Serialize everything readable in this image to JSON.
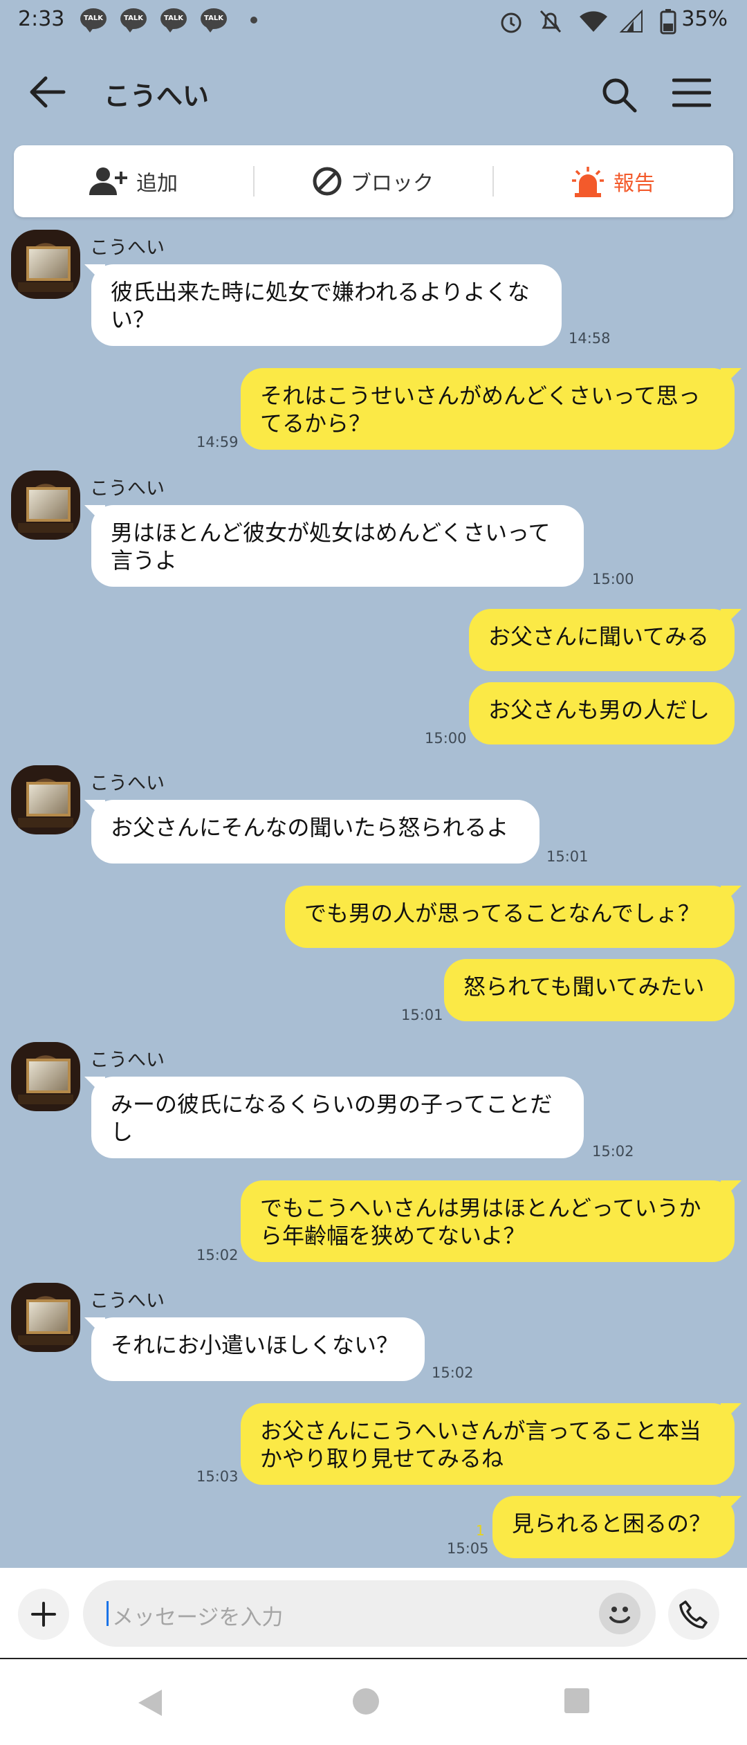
{
  "status": {
    "time": "2:33",
    "talk_label": "TALK",
    "battery": "35%"
  },
  "header": {
    "title": "こうへい"
  },
  "actions": {
    "add": "追加",
    "block": "ブロック",
    "report": "報告"
  },
  "messages": [
    {
      "sender": "こうへい",
      "text": "彼氏出来た時に処女で嫌われるよりよくな\nい？",
      "time": "14:58"
    },
    {
      "text": "それはこうせいさんがめんどくさいって思っ\nてるから？",
      "time": "14:59"
    },
    {
      "sender": "こうへい",
      "text": "男はほとんど彼女が処女はめんどくさいって\n言うよ",
      "time": "15:00"
    },
    {
      "text": "お父さんに聞いてみる"
    },
    {
      "text": "お父さんも男の人だし",
      "time": "15:00"
    },
    {
      "sender": "こうへい",
      "text": "お父さんにそんなの聞いたら怒られるよ",
      "time": "15:01"
    },
    {
      "text": "でも男の人が思ってることなんでしょ？"
    },
    {
      "text": "怒られても聞いてみたい",
      "time": "15:01"
    },
    {
      "sender": "こうへい",
      "text": "みーの彼氏になるくらいの男の子ってことだ\nし",
      "time": "15:02"
    },
    {
      "text": "でもこうへいさんは男はほとんどっていうか\nら年齢幅を狭めてないよ？",
      "time": "15:02"
    },
    {
      "sender": "こうへい",
      "text": "それにお小遣いほしくない？",
      "time": "15:02"
    },
    {
      "text": "お父さんにこうへいさんが言ってること本当\nかやり取り見せてみるね",
      "time": "15:03"
    },
    {
      "text": "見られると困るの？",
      "time": "15:05",
      "read": "1"
    }
  ],
  "input": {
    "placeholder": "メッセージを入力"
  }
}
